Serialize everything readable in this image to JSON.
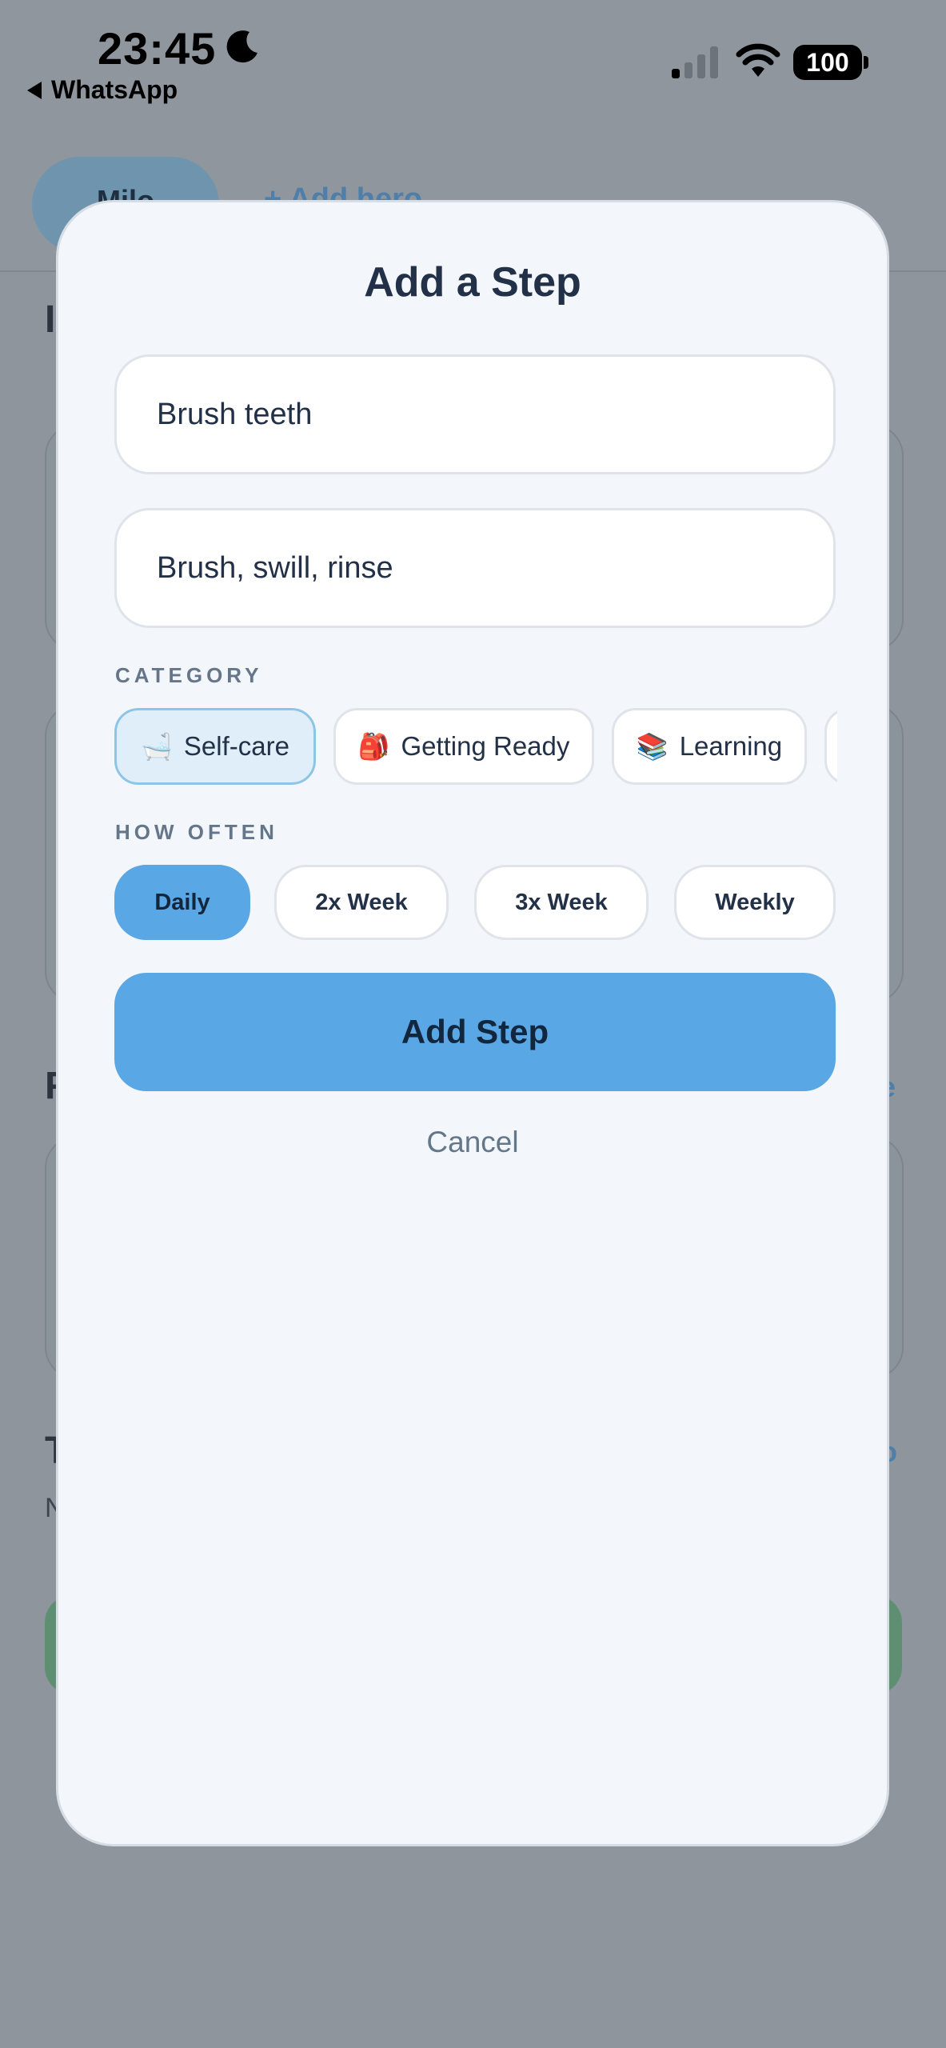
{
  "status_bar": {
    "time": "23:45",
    "back_app": "WhatsApp",
    "battery": "100"
  },
  "background": {
    "profile_pill": "Milo",
    "add_hero": "+ Add hero",
    "letters": [
      "I",
      "F",
      "T",
      "N"
    ],
    "links": [
      "e",
      "o"
    ],
    "accent_color": "#5aa7e5",
    "success_color": "#5f8f72"
  },
  "modal": {
    "title": "Add a Step",
    "step_name": {
      "value": "Brush teeth",
      "placeholder": ""
    },
    "step_description": {
      "value": "Brush, swill, rinse",
      "placeholder": ""
    },
    "category_label": "CATEGORY",
    "categories": [
      {
        "emoji": "🛁",
        "label": "Self-care",
        "selected": true
      },
      {
        "emoji": "🎒",
        "label": "Getting Ready",
        "selected": false
      },
      {
        "emoji": "📚",
        "label": "Learning",
        "selected": false
      }
    ],
    "frequency_label": "HOW OFTEN",
    "frequencies": [
      {
        "label": "Daily",
        "selected": true
      },
      {
        "label": "2x Week",
        "selected": false
      },
      {
        "label": "3x Week",
        "selected": false
      },
      {
        "label": "Weekly",
        "selected": false
      }
    ],
    "add_button": "Add Step",
    "cancel": "Cancel"
  }
}
